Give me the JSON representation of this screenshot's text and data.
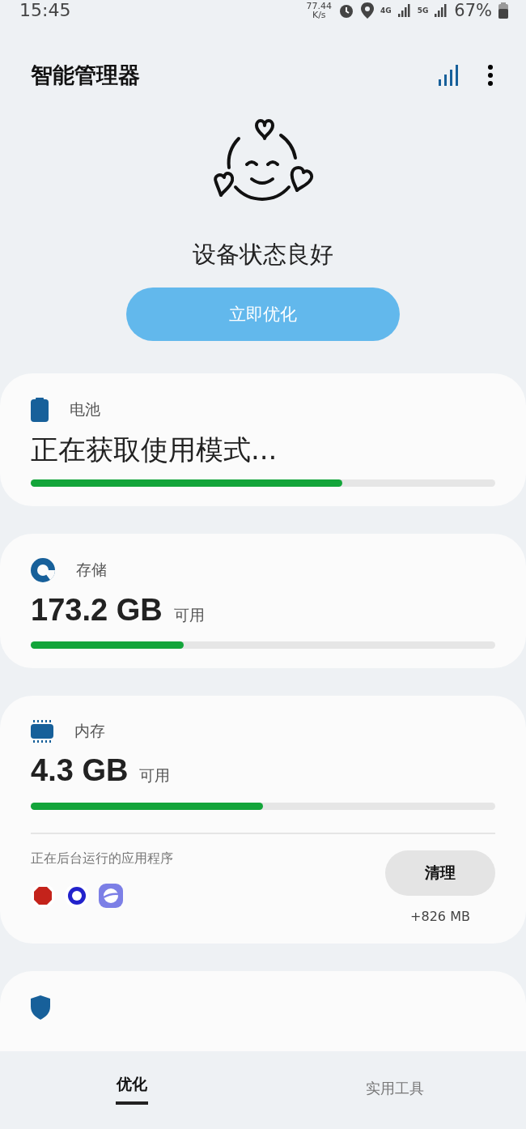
{
  "status_bar": {
    "time": "15:45",
    "speed_value": "77.44",
    "speed_unit": "K/s",
    "network_4g": "4G",
    "network_5g": "5G",
    "battery": "67%"
  },
  "app_bar": {
    "title": "智能管理器"
  },
  "hero": {
    "status": "设备状态良好",
    "button": "立即优化"
  },
  "cards": [
    {
      "kind": "battery",
      "title": "电池",
      "headline": "正在获取使用模式...",
      "level": 0.67
    },
    {
      "kind": "storage",
      "title": "存储",
      "value": "173.2 GB",
      "unit": "可用",
      "level": 0.33
    },
    {
      "kind": "memory",
      "title": "内存",
      "value": "4.3 GB",
      "unit": "可用",
      "level": 0.5,
      "apps_label": "正在后台运行的应用程序",
      "clean_button": "清理",
      "clean_amount": "+826 MB"
    },
    {
      "kind": "protection"
    }
  ],
  "bottom_tabs": [
    {
      "label": "优化",
      "selected": true
    },
    {
      "label": "实用工具",
      "selected": false
    }
  ]
}
